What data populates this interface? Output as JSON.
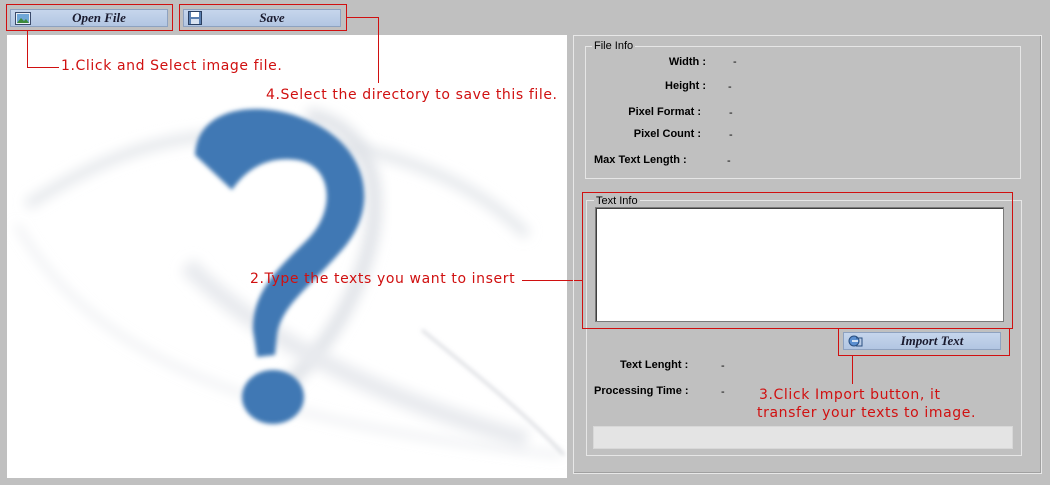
{
  "toolbar": {
    "open_label": "Open File",
    "save_label": "Save"
  },
  "annotations": {
    "step1": "1.Click and Select image file.",
    "step2": "2.Type the texts you want to insert",
    "step3_line1": "3.Click Import button, it",
    "step3_line2": "transfer your texts to image.",
    "step4": "4.Select the directory to save this file."
  },
  "file_info": {
    "title": "File Info",
    "width_label": "Width :",
    "width_value": "-",
    "height_label": "Height :",
    "height_value": "-",
    "pixel_format_label": "Pixel Format :",
    "pixel_format_value": "-",
    "pixel_count_label": "Pixel Count :",
    "pixel_count_value": "-",
    "max_text_label": "Max Text Length :",
    "max_text_value": "-"
  },
  "text_info": {
    "title": "Text Info",
    "text_value": "",
    "import_label": "Import Text",
    "text_length_label": "Text Lenght :",
    "text_length_value": "-",
    "processing_time_label": "Processing Time :",
    "processing_time_value": "-"
  },
  "colors": {
    "annotation_red": "#d01010",
    "button_blue": "#b8cae4",
    "question_mark_blue": "#3f78b4",
    "background_gray": "#c0c0c0"
  },
  "icons": {
    "open_icon": "image-file-icon",
    "save_icon": "floppy-disk-icon",
    "import_icon": "import-icon",
    "placeholder": "question-mark-image"
  }
}
